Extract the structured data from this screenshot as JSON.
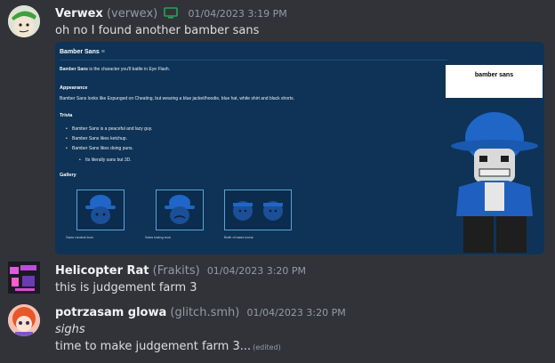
{
  "messages": [
    {
      "author": "Verwex",
      "handle": "(verwex)",
      "timestamp": "01/04/2023 3:19 PM",
      "device_icon": "desktop-icon",
      "text": "oh no I found another bamber sans"
    },
    {
      "author": "Helicopter Rat",
      "handle": "(Frakits)",
      "timestamp": "01/04/2023 3:20 PM",
      "text": "this is judgement farm 3"
    },
    {
      "author": "potrzasam glowa",
      "handle": "(glitch.smh)",
      "timestamp": "01/04/2023 3:20 PM",
      "text_italic": "sighs",
      "text": "time to make judgement farm 3...",
      "edited": "(edited)"
    }
  ],
  "embed": {
    "page_title": "Bamber Sans",
    "intro_bold": "Bamber Sans",
    "intro_rest": " is the character you'll battle in Eye Flash.",
    "appearance_heading": "Appearance",
    "appearance_text": "Bamber Sans looks like Expunged on Cheating, but wearing a blue jacket/hoodie, blue hat, white shirt and black shorts.",
    "trivia_heading": "Trivia",
    "trivia": [
      "Bamber Sans is a peaceful and lazy guy.",
      "Bamber Sans likes ketchup.",
      "Bamber Sans likes doing puns."
    ],
    "trivia_sub": "Its literally sans but 3D.",
    "gallery_heading": "Gallery",
    "gallery_captions": [
      "Sans neutral icon",
      "Sans losing icon",
      "Both of sans icons"
    ],
    "infobox_title": "bamber sans"
  },
  "colors": {
    "background": "#323339",
    "embed_bg": "#0e3356",
    "hat_blue": "#1f66c7",
    "online_green": "#23a55a"
  }
}
